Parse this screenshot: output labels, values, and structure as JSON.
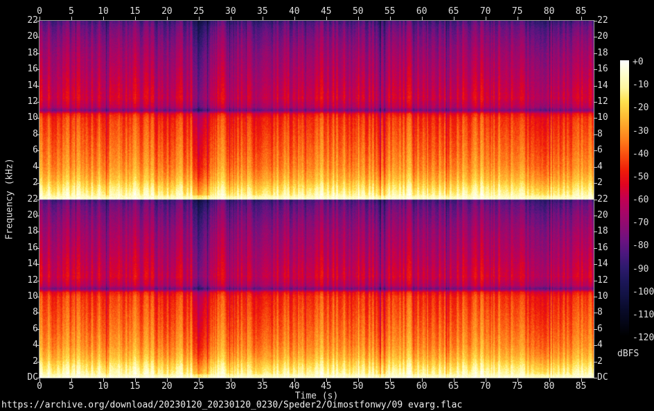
{
  "page": {
    "background": "#000000",
    "source_url": "https://archive.org/download/20230120_20230120_0230/Speder2/Oimostfonwy/09 evarg.flac"
  },
  "chart_data": {
    "type": "heatmap",
    "subtype": "stereo-audio-spectrogram",
    "channels": 2,
    "duration_s": 87,
    "x_axis": {
      "label": "Time (s)",
      "tick_values": [
        0,
        5,
        10,
        15,
        20,
        25,
        30,
        35,
        40,
        45,
        50,
        55,
        60,
        65,
        70,
        75,
        80,
        85
      ],
      "range": [
        0,
        87
      ],
      "ticks_on": "top-and-bottom"
    },
    "y_axis": {
      "label": "Frequency (kHz)",
      "tick_values_khz": [
        22,
        20,
        18,
        16,
        14,
        12,
        10,
        8,
        6,
        4,
        2
      ],
      "dc_label": "DC",
      "range_khz": [
        0,
        22
      ],
      "labels_on": "left-and-right",
      "per_channel": true
    },
    "colorbar": {
      "label": "dBFS",
      "tick_labels": [
        "+0",
        "-10",
        "-20",
        "-30",
        "-40",
        "-50",
        "-60",
        "-70",
        "-80",
        "-90",
        "-100",
        "-110",
        "-120"
      ],
      "range_db": [
        0,
        -120
      ],
      "palette_stops": [
        [
          0,
          "#ffffff"
        ],
        [
          -6,
          "#ffffcd"
        ],
        [
          -12,
          "#fff7a0"
        ],
        [
          -18,
          "#ffe14e"
        ],
        [
          -24,
          "#ffbf36"
        ],
        [
          -30,
          "#ff9b26"
        ],
        [
          -36,
          "#ff7418"
        ],
        [
          -42,
          "#f8480e"
        ],
        [
          -48,
          "#ef1c09"
        ],
        [
          -54,
          "#e00420"
        ],
        [
          -60,
          "#c40050"
        ],
        [
          -66,
          "#a80566"
        ],
        [
          -72,
          "#8d0c72"
        ],
        [
          -78,
          "#6e1280"
        ],
        [
          -84,
          "#4c177e"
        ],
        [
          -90,
          "#2e1a6e"
        ],
        [
          -96,
          "#1c1659"
        ],
        [
          -102,
          "#121244"
        ],
        [
          -108,
          "#090b2c"
        ],
        [
          -114,
          "#040617"
        ],
        [
          -120,
          "#000000"
        ]
      ]
    },
    "band_profile_db": [
      [
        0,
        -3
      ],
      [
        0.25,
        -7
      ],
      [
        0.7,
        -12
      ],
      [
        1.5,
        -18
      ],
      [
        2.5,
        -26
      ],
      [
        4,
        -33
      ],
      [
        6,
        -38
      ],
      [
        8,
        -42
      ],
      [
        10,
        -46
      ],
      [
        10.6,
        -52
      ],
      [
        11,
        -76
      ],
      [
        11.4,
        -64
      ],
      [
        12.5,
        -58
      ],
      [
        14,
        -61
      ],
      [
        16,
        -65
      ],
      [
        18,
        -69
      ],
      [
        20,
        -75
      ],
      [
        21.3,
        -80
      ],
      [
        22,
        -86
      ]
    ],
    "quiet_zones": [
      {
        "start_s": 24.2,
        "end_s": 26.5,
        "attenuation_db": 16
      }
    ],
    "texture": {
      "stripe_db": 8,
      "slow_envelope_db": 4,
      "pixel_noise_db": 6.4,
      "stripe_scale": 2.6,
      "dark_line_chance": 0.05,
      "dark_line_db": 12
    }
  }
}
